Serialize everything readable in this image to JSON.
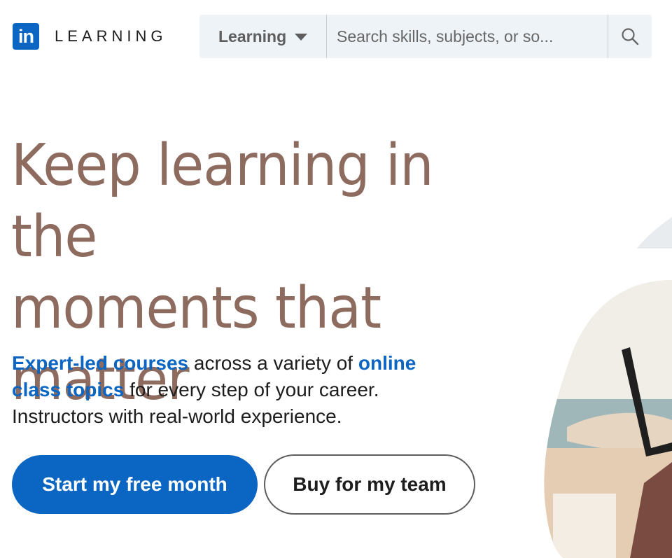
{
  "brand": {
    "badge": "in",
    "wordmark": "LEARNING",
    "color": "#0a66c2"
  },
  "search": {
    "scope_label": "Learning",
    "placeholder": "Search skills, subjects, or so...",
    "value": "",
    "button_icon": "search-icon"
  },
  "hero": {
    "headline_lines": [
      "Keep learning in the",
      "moments that",
      "matter"
    ],
    "headline_color": "#8e6b5f",
    "sub": {
      "link1": "Expert-led courses",
      "text1": " across a variety of ",
      "link2": "online class topics",
      "text2": " for every step of your career.",
      "line3": "Instructors with real-world experience."
    },
    "cta_primary": "Start my free month",
    "cta_secondary": "Buy for my team"
  },
  "colors": {
    "primary": "#0a66c2",
    "search_bg": "#eef3f8"
  }
}
